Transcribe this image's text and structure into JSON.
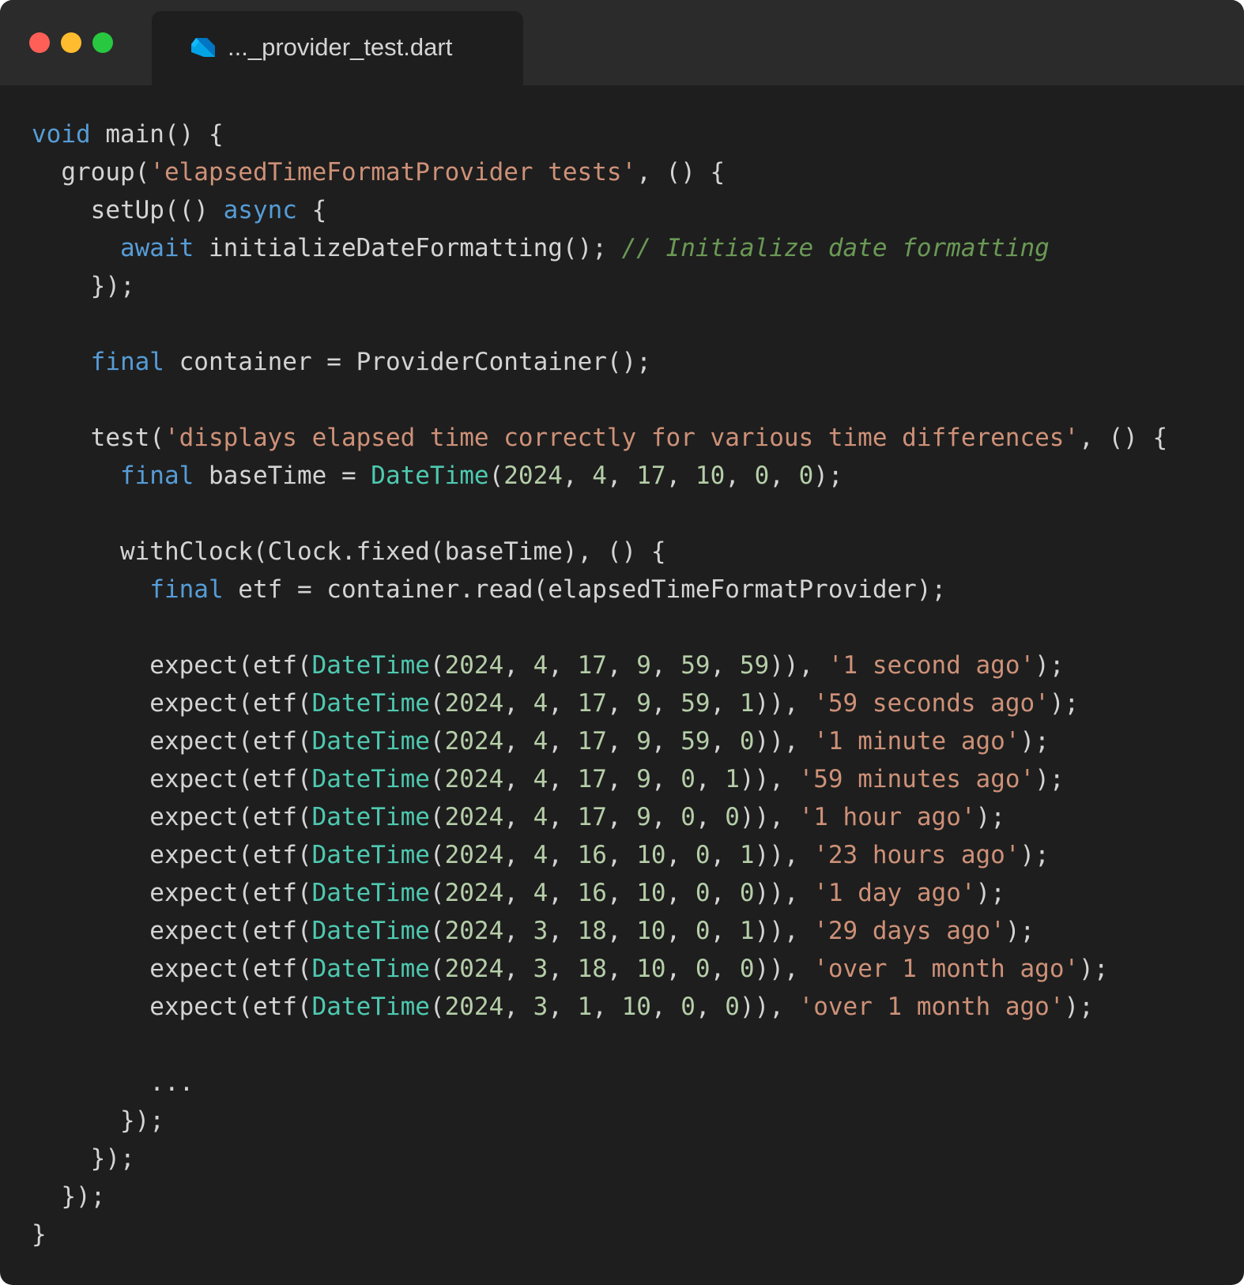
{
  "window": {
    "traffic_lights": {
      "close_color": "#ff5f57",
      "minimize_color": "#febc2e",
      "zoom_color": "#28c840"
    },
    "tab": {
      "icon": "dart-icon",
      "label": "..._provider_test.dart"
    }
  },
  "theme": {
    "keyword": "#569cd6",
    "string": "#ce9178",
    "comment": "#6a9955",
    "type": "#4ec9b0",
    "number": "#b5cea8",
    "default": "#d4d4d4"
  },
  "code": {
    "lines": [
      {
        "tokens": [
          {
            "t": "kw",
            "v": "void"
          },
          {
            "t": "plain",
            "v": " main() {"
          }
        ]
      },
      {
        "tokens": [
          {
            "t": "plain",
            "v": "  group("
          },
          {
            "t": "str",
            "v": "'elapsedTimeFormatProvider tests'"
          },
          {
            "t": "plain",
            "v": ", () {"
          }
        ]
      },
      {
        "tokens": [
          {
            "t": "plain",
            "v": "    setUp(() "
          },
          {
            "t": "kw",
            "v": "async"
          },
          {
            "t": "plain",
            "v": " {"
          }
        ]
      },
      {
        "tokens": [
          {
            "t": "plain",
            "v": "      "
          },
          {
            "t": "kw",
            "v": "await"
          },
          {
            "t": "plain",
            "v": " initializeDateFormatting(); "
          },
          {
            "t": "cmt",
            "v": "// Initialize date formatting"
          }
        ]
      },
      {
        "tokens": [
          {
            "t": "plain",
            "v": "    });"
          }
        ]
      },
      {
        "tokens": [],
        "gap": true
      },
      {
        "tokens": [
          {
            "t": "plain",
            "v": "    "
          },
          {
            "t": "kw",
            "v": "final"
          },
          {
            "t": "plain",
            "v": " container = ProviderContainer();"
          }
        ]
      },
      {
        "tokens": [],
        "gap": true
      },
      {
        "tokens": [
          {
            "t": "plain",
            "v": "    test("
          },
          {
            "t": "str",
            "v": "'displays elapsed time correctly for various time differences'"
          },
          {
            "t": "plain",
            "v": ", () {"
          }
        ]
      },
      {
        "tokens": [
          {
            "t": "plain",
            "v": "      "
          },
          {
            "t": "kw",
            "v": "final"
          },
          {
            "t": "plain",
            "v": " baseTime = "
          },
          {
            "t": "type",
            "v": "DateTime"
          },
          {
            "t": "plain",
            "v": "("
          },
          {
            "t": "num",
            "v": "2024"
          },
          {
            "t": "plain",
            "v": ", "
          },
          {
            "t": "num",
            "v": "4"
          },
          {
            "t": "plain",
            "v": ", "
          },
          {
            "t": "num",
            "v": "17"
          },
          {
            "t": "plain",
            "v": ", "
          },
          {
            "t": "num",
            "v": "10"
          },
          {
            "t": "plain",
            "v": ", "
          },
          {
            "t": "num",
            "v": "0"
          },
          {
            "t": "plain",
            "v": ", "
          },
          {
            "t": "num",
            "v": "0"
          },
          {
            "t": "plain",
            "v": ");"
          }
        ]
      },
      {
        "tokens": [],
        "gap": true
      },
      {
        "tokens": [
          {
            "t": "plain",
            "v": "      withClock(Clock.fixed(baseTime), () {"
          }
        ]
      },
      {
        "tokens": [
          {
            "t": "plain",
            "v": "        "
          },
          {
            "t": "kw",
            "v": "final"
          },
          {
            "t": "plain",
            "v": " etf = container.read(elapsedTimeFormatProvider);"
          }
        ]
      },
      {
        "tokens": [],
        "gap": true
      },
      {
        "tokens": [
          {
            "t": "plain",
            "v": "        expect(etf("
          },
          {
            "t": "type",
            "v": "DateTime"
          },
          {
            "t": "plain",
            "v": "("
          },
          {
            "t": "num",
            "v": "2024"
          },
          {
            "t": "plain",
            "v": ", "
          },
          {
            "t": "num",
            "v": "4"
          },
          {
            "t": "plain",
            "v": ", "
          },
          {
            "t": "num",
            "v": "17"
          },
          {
            "t": "plain",
            "v": ", "
          },
          {
            "t": "num",
            "v": "9"
          },
          {
            "t": "plain",
            "v": ", "
          },
          {
            "t": "num",
            "v": "59"
          },
          {
            "t": "plain",
            "v": ", "
          },
          {
            "t": "num",
            "v": "59"
          },
          {
            "t": "plain",
            "v": ")), "
          },
          {
            "t": "str",
            "v": "'1 second ago'"
          },
          {
            "t": "plain",
            "v": ");"
          }
        ]
      },
      {
        "tokens": [
          {
            "t": "plain",
            "v": "        expect(etf("
          },
          {
            "t": "type",
            "v": "DateTime"
          },
          {
            "t": "plain",
            "v": "("
          },
          {
            "t": "num",
            "v": "2024"
          },
          {
            "t": "plain",
            "v": ", "
          },
          {
            "t": "num",
            "v": "4"
          },
          {
            "t": "plain",
            "v": ", "
          },
          {
            "t": "num",
            "v": "17"
          },
          {
            "t": "plain",
            "v": ", "
          },
          {
            "t": "num",
            "v": "9"
          },
          {
            "t": "plain",
            "v": ", "
          },
          {
            "t": "num",
            "v": "59"
          },
          {
            "t": "plain",
            "v": ", "
          },
          {
            "t": "num",
            "v": "1"
          },
          {
            "t": "plain",
            "v": ")), "
          },
          {
            "t": "str",
            "v": "'59 seconds ago'"
          },
          {
            "t": "plain",
            "v": ");"
          }
        ]
      },
      {
        "tokens": [
          {
            "t": "plain",
            "v": "        expect(etf("
          },
          {
            "t": "type",
            "v": "DateTime"
          },
          {
            "t": "plain",
            "v": "("
          },
          {
            "t": "num",
            "v": "2024"
          },
          {
            "t": "plain",
            "v": ", "
          },
          {
            "t": "num",
            "v": "4"
          },
          {
            "t": "plain",
            "v": ", "
          },
          {
            "t": "num",
            "v": "17"
          },
          {
            "t": "plain",
            "v": ", "
          },
          {
            "t": "num",
            "v": "9"
          },
          {
            "t": "plain",
            "v": ", "
          },
          {
            "t": "num",
            "v": "59"
          },
          {
            "t": "plain",
            "v": ", "
          },
          {
            "t": "num",
            "v": "0"
          },
          {
            "t": "plain",
            "v": ")), "
          },
          {
            "t": "str",
            "v": "'1 minute ago'"
          },
          {
            "t": "plain",
            "v": ");"
          }
        ]
      },
      {
        "tokens": [
          {
            "t": "plain",
            "v": "        expect(etf("
          },
          {
            "t": "type",
            "v": "DateTime"
          },
          {
            "t": "plain",
            "v": "("
          },
          {
            "t": "num",
            "v": "2024"
          },
          {
            "t": "plain",
            "v": ", "
          },
          {
            "t": "num",
            "v": "4"
          },
          {
            "t": "plain",
            "v": ", "
          },
          {
            "t": "num",
            "v": "17"
          },
          {
            "t": "plain",
            "v": ", "
          },
          {
            "t": "num",
            "v": "9"
          },
          {
            "t": "plain",
            "v": ", "
          },
          {
            "t": "num",
            "v": "0"
          },
          {
            "t": "plain",
            "v": ", "
          },
          {
            "t": "num",
            "v": "1"
          },
          {
            "t": "plain",
            "v": ")), "
          },
          {
            "t": "str",
            "v": "'59 minutes ago'"
          },
          {
            "t": "plain",
            "v": ");"
          }
        ]
      },
      {
        "tokens": [
          {
            "t": "plain",
            "v": "        expect(etf("
          },
          {
            "t": "type",
            "v": "DateTime"
          },
          {
            "t": "plain",
            "v": "("
          },
          {
            "t": "num",
            "v": "2024"
          },
          {
            "t": "plain",
            "v": ", "
          },
          {
            "t": "num",
            "v": "4"
          },
          {
            "t": "plain",
            "v": ", "
          },
          {
            "t": "num",
            "v": "17"
          },
          {
            "t": "plain",
            "v": ", "
          },
          {
            "t": "num",
            "v": "9"
          },
          {
            "t": "plain",
            "v": ", "
          },
          {
            "t": "num",
            "v": "0"
          },
          {
            "t": "plain",
            "v": ", "
          },
          {
            "t": "num",
            "v": "0"
          },
          {
            "t": "plain",
            "v": ")), "
          },
          {
            "t": "str",
            "v": "'1 hour ago'"
          },
          {
            "t": "plain",
            "v": ");"
          }
        ]
      },
      {
        "tokens": [
          {
            "t": "plain",
            "v": "        expect(etf("
          },
          {
            "t": "type",
            "v": "DateTime"
          },
          {
            "t": "plain",
            "v": "("
          },
          {
            "t": "num",
            "v": "2024"
          },
          {
            "t": "plain",
            "v": ", "
          },
          {
            "t": "num",
            "v": "4"
          },
          {
            "t": "plain",
            "v": ", "
          },
          {
            "t": "num",
            "v": "16"
          },
          {
            "t": "plain",
            "v": ", "
          },
          {
            "t": "num",
            "v": "10"
          },
          {
            "t": "plain",
            "v": ", "
          },
          {
            "t": "num",
            "v": "0"
          },
          {
            "t": "plain",
            "v": ", "
          },
          {
            "t": "num",
            "v": "1"
          },
          {
            "t": "plain",
            "v": ")), "
          },
          {
            "t": "str",
            "v": "'23 hours ago'"
          },
          {
            "t": "plain",
            "v": ");"
          }
        ]
      },
      {
        "tokens": [
          {
            "t": "plain",
            "v": "        expect(etf("
          },
          {
            "t": "type",
            "v": "DateTime"
          },
          {
            "t": "plain",
            "v": "("
          },
          {
            "t": "num",
            "v": "2024"
          },
          {
            "t": "plain",
            "v": ", "
          },
          {
            "t": "num",
            "v": "4"
          },
          {
            "t": "plain",
            "v": ", "
          },
          {
            "t": "num",
            "v": "16"
          },
          {
            "t": "plain",
            "v": ", "
          },
          {
            "t": "num",
            "v": "10"
          },
          {
            "t": "plain",
            "v": ", "
          },
          {
            "t": "num",
            "v": "0"
          },
          {
            "t": "plain",
            "v": ", "
          },
          {
            "t": "num",
            "v": "0"
          },
          {
            "t": "plain",
            "v": ")), "
          },
          {
            "t": "str",
            "v": "'1 day ago'"
          },
          {
            "t": "plain",
            "v": ");"
          }
        ]
      },
      {
        "tokens": [
          {
            "t": "plain",
            "v": "        expect(etf("
          },
          {
            "t": "type",
            "v": "DateTime"
          },
          {
            "t": "plain",
            "v": "("
          },
          {
            "t": "num",
            "v": "2024"
          },
          {
            "t": "plain",
            "v": ", "
          },
          {
            "t": "num",
            "v": "3"
          },
          {
            "t": "plain",
            "v": ", "
          },
          {
            "t": "num",
            "v": "18"
          },
          {
            "t": "plain",
            "v": ", "
          },
          {
            "t": "num",
            "v": "10"
          },
          {
            "t": "plain",
            "v": ", "
          },
          {
            "t": "num",
            "v": "0"
          },
          {
            "t": "plain",
            "v": ", "
          },
          {
            "t": "num",
            "v": "1"
          },
          {
            "t": "plain",
            "v": ")), "
          },
          {
            "t": "str",
            "v": "'29 days ago'"
          },
          {
            "t": "plain",
            "v": ");"
          }
        ]
      },
      {
        "tokens": [
          {
            "t": "plain",
            "v": "        expect(etf("
          },
          {
            "t": "type",
            "v": "DateTime"
          },
          {
            "t": "plain",
            "v": "("
          },
          {
            "t": "num",
            "v": "2024"
          },
          {
            "t": "plain",
            "v": ", "
          },
          {
            "t": "num",
            "v": "3"
          },
          {
            "t": "plain",
            "v": ", "
          },
          {
            "t": "num",
            "v": "18"
          },
          {
            "t": "plain",
            "v": ", "
          },
          {
            "t": "num",
            "v": "10"
          },
          {
            "t": "plain",
            "v": ", "
          },
          {
            "t": "num",
            "v": "0"
          },
          {
            "t": "plain",
            "v": ", "
          },
          {
            "t": "num",
            "v": "0"
          },
          {
            "t": "plain",
            "v": ")), "
          },
          {
            "t": "str",
            "v": "'over 1 month ago'"
          },
          {
            "t": "plain",
            "v": ");"
          }
        ]
      },
      {
        "tokens": [
          {
            "t": "plain",
            "v": "        expect(etf("
          },
          {
            "t": "type",
            "v": "DateTime"
          },
          {
            "t": "plain",
            "v": "("
          },
          {
            "t": "num",
            "v": "2024"
          },
          {
            "t": "plain",
            "v": ", "
          },
          {
            "t": "num",
            "v": "3"
          },
          {
            "t": "plain",
            "v": ", "
          },
          {
            "t": "num",
            "v": "1"
          },
          {
            "t": "plain",
            "v": ", "
          },
          {
            "t": "num",
            "v": "10"
          },
          {
            "t": "plain",
            "v": ", "
          },
          {
            "t": "num",
            "v": "0"
          },
          {
            "t": "plain",
            "v": ", "
          },
          {
            "t": "num",
            "v": "0"
          },
          {
            "t": "plain",
            "v": ")), "
          },
          {
            "t": "str",
            "v": "'over 1 month ago'"
          },
          {
            "t": "plain",
            "v": ");"
          }
        ]
      },
      {
        "tokens": [],
        "gap": true
      },
      {
        "tokens": [
          {
            "t": "plain",
            "v": "        ..."
          }
        ]
      },
      {
        "tokens": [
          {
            "t": "plain",
            "v": "      });"
          }
        ]
      },
      {
        "tokens": [
          {
            "t": "plain",
            "v": "    });"
          }
        ]
      },
      {
        "tokens": [
          {
            "t": "plain",
            "v": "  });"
          }
        ]
      },
      {
        "tokens": [
          {
            "t": "plain",
            "v": "}"
          }
        ]
      }
    ]
  }
}
